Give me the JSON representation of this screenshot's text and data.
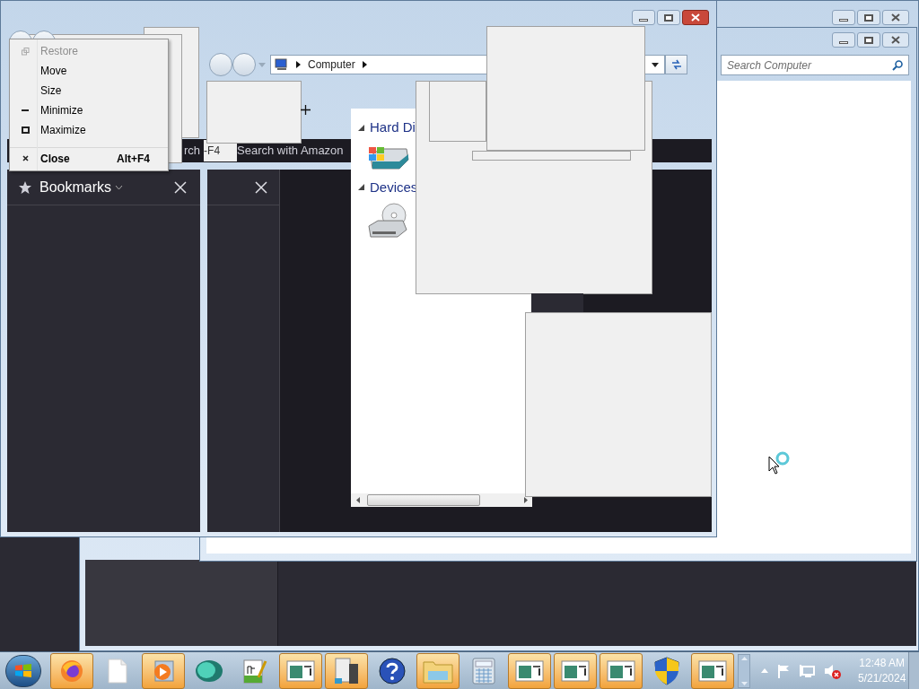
{
  "system_menu": {
    "items": [
      {
        "label": "Restore",
        "kind": "restore",
        "disabled": true,
        "default": false,
        "separator_before": false
      },
      {
        "label": "Move",
        "kind": "plain",
        "disabled": false,
        "default": false,
        "separator_before": false
      },
      {
        "label": "Size",
        "kind": "plain",
        "disabled": false,
        "default": false,
        "separator_before": false
      },
      {
        "label": "Minimize",
        "kind": "minimize",
        "disabled": false,
        "default": false,
        "separator_before": false
      },
      {
        "label": "Maximize",
        "kind": "maximize",
        "disabled": false,
        "default": false,
        "separator_before": false
      },
      {
        "label": "Close",
        "kind": "close",
        "disabled": false,
        "default": true,
        "separator_before": true,
        "shortcut": "Alt+F4"
      }
    ]
  },
  "explorer": {
    "breadcrumb": [
      "Computer"
    ],
    "search": {
      "placeholder": "Search Computer"
    },
    "groups": [
      {
        "label": "Hard Di",
        "expanded": true,
        "kind": "hard-disk"
      },
      {
        "label": "Devices",
        "expanded": true,
        "kind": "optical-drive"
      }
    ]
  },
  "browser": {
    "toolbar_texts": [
      "rch",
      "-F4",
      "Search with Amazon"
    ],
    "sidebar": {
      "title": "Bookmarks"
    }
  },
  "taskbar": {
    "items": [
      {
        "kind": "firefox",
        "highlighted": true
      },
      {
        "kind": "document",
        "highlighted": false
      },
      {
        "kind": "media-player",
        "highlighted": true
      },
      {
        "kind": "globe",
        "highlighted": false
      },
      {
        "kind": "notepad",
        "highlighted": false
      },
      {
        "kind": "window",
        "highlighted": true
      },
      {
        "kind": "server",
        "highlighted": true
      },
      {
        "kind": "help",
        "highlighted": false
      },
      {
        "kind": "folder",
        "highlighted": true
      },
      {
        "kind": "calculator",
        "highlighted": false
      },
      {
        "kind": "window",
        "highlighted": true
      },
      {
        "kind": "window",
        "highlighted": true
      },
      {
        "kind": "window",
        "highlighted": true
      },
      {
        "kind": "shield",
        "highlighted": false
      },
      {
        "kind": "window",
        "highlighted": true
      }
    ],
    "volume_muted": true,
    "clock": {
      "time": "12:48 AM",
      "date": "5/21/2024"
    }
  }
}
